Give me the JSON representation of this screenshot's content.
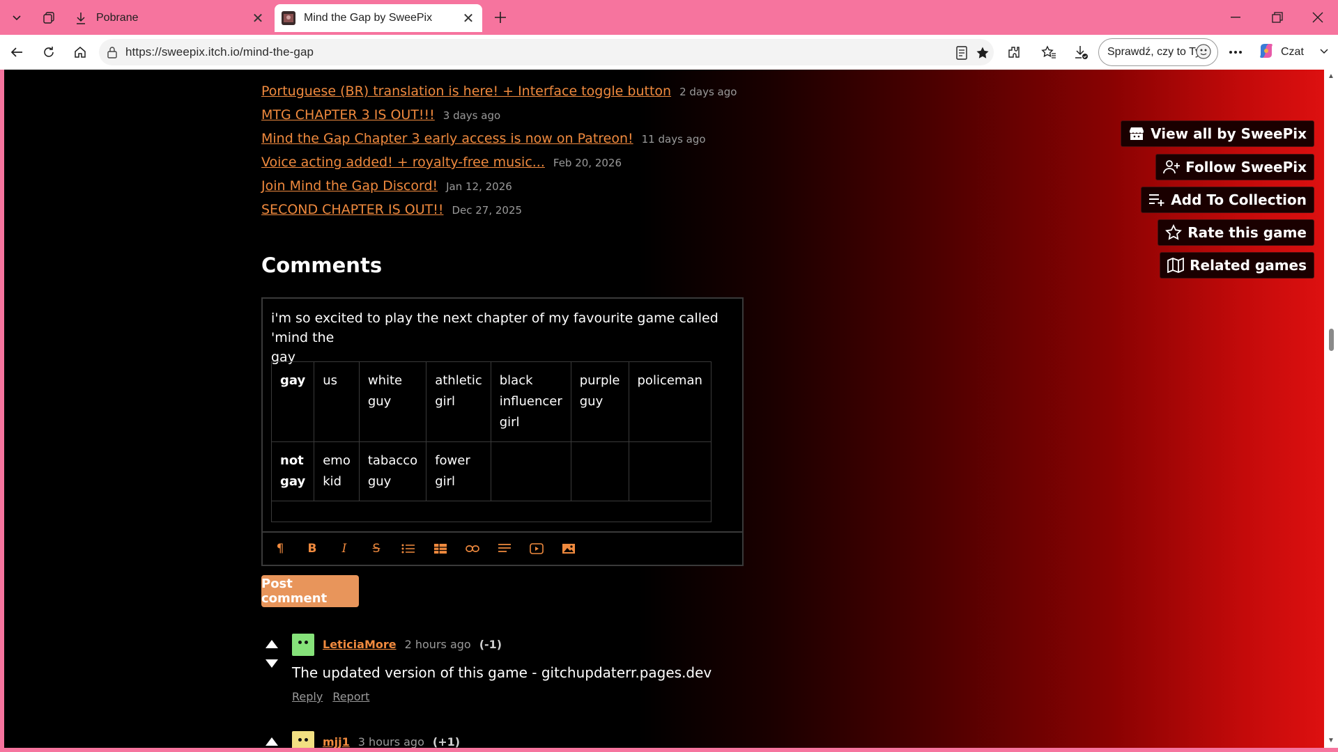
{
  "browser": {
    "tabs": [
      {
        "title": "Pobrane",
        "active": false
      },
      {
        "title": "Mind the Gap by SweePix",
        "active": true
      }
    ],
    "url": "https://sweepix.itch.io/mind-the-gap",
    "search_pill_label": "Sprawdź, czy to Ty",
    "copilot_label": "Czat"
  },
  "devlogs": [
    {
      "title": "Portuguese (BR) translation is here! + Interface toggle button",
      "date": "2 days ago"
    },
    {
      "title": "MTG CHAPTER 3 IS OUT!!!",
      "date": "3 days ago"
    },
    {
      "title": "Mind the Gap Chapter 3 early access is now on Patreon!",
      "date": "11 days ago"
    },
    {
      "title": "Voice acting added! + royalty-free music...",
      "date": "Feb 20, 2026"
    },
    {
      "title": "Join Mind the Gap Discord!",
      "date": "Jan 12, 2026"
    },
    {
      "title": "SECOND CHAPTER IS OUT!!",
      "date": "Dec 27, 2025"
    }
  ],
  "comments_section": {
    "title": "Comments",
    "editor": {
      "text_line1": "i'm so excited to play the next chapter of my favourite game called 'mind the",
      "text_line2": "gay",
      "table": {
        "row1": [
          "gay",
          "us",
          "white guy",
          "athletic girl",
          "black influencer girl",
          "purple guy",
          "policeman"
        ],
        "row2": [
          "not gay",
          "emo kid",
          "tabacco guy",
          "fower girl",
          "",
          "",
          ""
        ]
      }
    },
    "post_button": "Post comment",
    "comments": [
      {
        "user": "LeticiaMore",
        "time": "2 hours ago",
        "score": "(-1)",
        "body": "The updated version of this game - gitchupdaterr.pages.dev",
        "reply": "Reply",
        "report": "Report"
      },
      {
        "user": "mjj1",
        "time": "3 hours ago",
        "score": "(+1)"
      }
    ]
  },
  "sidebar_buttons": [
    {
      "label": "View all by SweePix",
      "icon": "itchio-icon"
    },
    {
      "label": "Follow SweePix",
      "icon": "user-plus-icon"
    },
    {
      "label": "Add To Collection",
      "icon": "playlist-add-icon"
    },
    {
      "label": "Rate this game",
      "icon": "star-icon"
    },
    {
      "label": "Related games",
      "icon": "map-icon"
    }
  ],
  "colors": {
    "accent": "#f08a3e",
    "button": "#e8955b",
    "browser_frame": "#f6749e"
  }
}
